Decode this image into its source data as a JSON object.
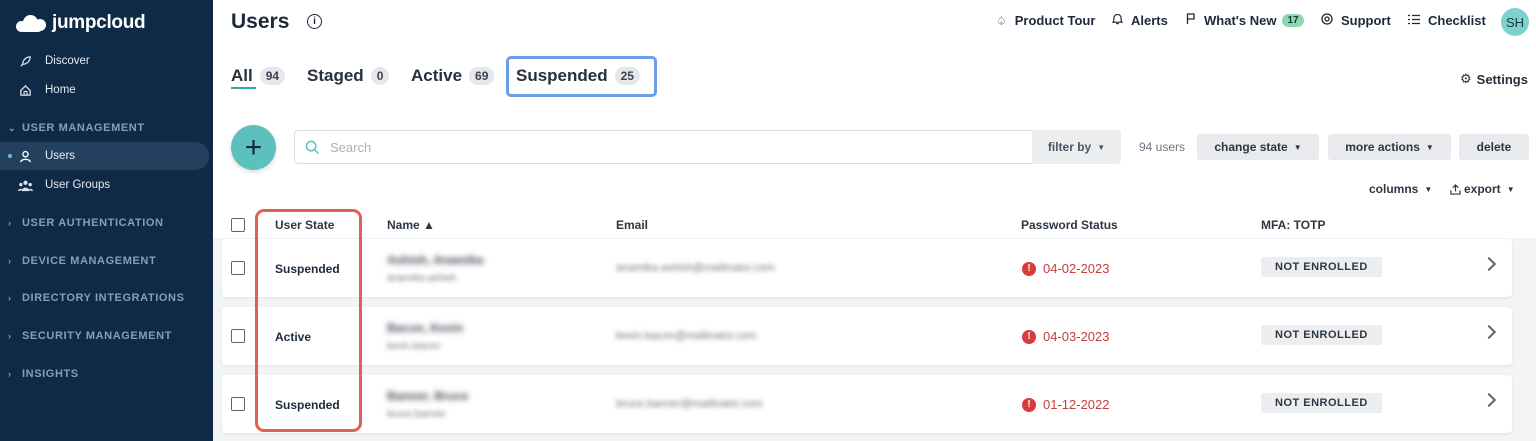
{
  "app": {
    "logo_text": "jumpcloud"
  },
  "sidebar": {
    "top_items": [
      {
        "label": "Discover",
        "icon": "rocket-icon"
      },
      {
        "label": "Home",
        "icon": "home-icon"
      }
    ],
    "sections": [
      {
        "label": "USER MANAGEMENT",
        "expanded": true
      },
      {
        "label": "USER AUTHENTICATION",
        "expanded": false
      },
      {
        "label": "DEVICE MANAGEMENT",
        "expanded": false
      },
      {
        "label": "DIRECTORY INTEGRATIONS",
        "expanded": false
      },
      {
        "label": "SECURITY MANAGEMENT",
        "expanded": false
      },
      {
        "label": "INSIGHTS",
        "expanded": false
      }
    ],
    "user_management_items": [
      {
        "label": "Users",
        "icon": "user-icon",
        "active": true
      },
      {
        "label": "User Groups",
        "icon": "user-groups-icon",
        "active": false
      }
    ]
  },
  "header": {
    "title": "Users",
    "nav": [
      {
        "label": "Product Tour",
        "icon": "bell-outline-icon"
      },
      {
        "label": "Alerts",
        "icon": "bell-icon"
      },
      {
        "label": "What's New",
        "icon": "flag-icon",
        "badge": "17"
      },
      {
        "label": "Support",
        "icon": "lifebuoy-icon"
      },
      {
        "label": "Checklist",
        "icon": "checklist-icon"
      }
    ],
    "avatar_initials": "SH"
  },
  "tabs": [
    {
      "label": "All",
      "count": "94",
      "active": true
    },
    {
      "label": "Staged",
      "count": "0"
    },
    {
      "label": "Active",
      "count": "69"
    },
    {
      "label": "Suspended",
      "count": "25"
    }
  ],
  "settings_label": "Settings",
  "toolbar": {
    "search_placeholder": "Search",
    "filter_label": "filter by",
    "users_count": "94 users",
    "change_state_label": "change state",
    "more_actions_label": "more actions",
    "delete_label": "delete",
    "columns_label": "columns",
    "export_label": "export"
  },
  "table": {
    "headers": [
      "User State",
      "Name ▲",
      "Email",
      "Password Status",
      "MFA: TOTP"
    ],
    "rows": [
      {
        "state": "Suspended",
        "name": "Ashish, Anamika",
        "username": "anamika.ashish",
        "email": "anamika.ashish@mailinator.com",
        "password_status": "04-02-2023",
        "mfa": "NOT ENROLLED"
      },
      {
        "state": "Active",
        "name": "Bacon, Kevin",
        "username": "kevin.bacon",
        "email": "kevin.bacon@mailinator.com",
        "password_status": "04-03-2023",
        "mfa": "NOT ENROLLED"
      },
      {
        "state": "Suspended",
        "name": "Banner, Bruce",
        "username": "bruce.banner",
        "email": "bruce.banner@mailinator.com",
        "password_status": "01-12-2022",
        "mfa": "NOT ENROLLED"
      }
    ]
  },
  "colors": {
    "sidebar_bg": "#0f2a47",
    "accent_teal": "#5cc1bd",
    "error_red": "#c93c3c",
    "tab_highlight": "#6c9fe7",
    "state_highlight": "#e0614f"
  }
}
